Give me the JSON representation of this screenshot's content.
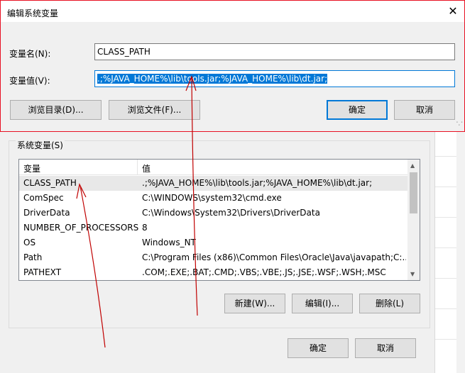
{
  "dialog": {
    "title": "编辑系统变量",
    "name_label": "变量名(N):",
    "name_value": "CLASS_PATH",
    "value_label": "变量值(V):",
    "value_text": ".;%JAVA_HOME%\\lib\\tools.jar;%JAVA_HOME%\\lib\\dt.jar;",
    "browse_dir": "浏览目录(D)...",
    "browse_file": "浏览文件(F)...",
    "ok": "确定",
    "cancel": "取消"
  },
  "sysvars": {
    "group_label": "系统变量(S)",
    "columns": [
      "变量",
      "值"
    ],
    "rows": [
      {
        "name": "CLASS_PATH",
        "value": ".;%JAVA_HOME%\\lib\\tools.jar;%JAVA_HOME%\\lib\\dt.jar;"
      },
      {
        "name": "ComSpec",
        "value": "C:\\WINDOWS\\system32\\cmd.exe"
      },
      {
        "name": "DriverData",
        "value": "C:\\Windows\\System32\\Drivers\\DriverData"
      },
      {
        "name": "NUMBER_OF_PROCESSORS",
        "value": "8"
      },
      {
        "name": "OS",
        "value": "Windows_NT"
      },
      {
        "name": "Path",
        "value": "C:\\Program Files (x86)\\Common Files\\Oracle\\Java\\javapath;C:..."
      },
      {
        "name": "PATHEXT",
        "value": ".COM;.EXE;.BAT;.CMD;.VBS;.VBE;.JS;.JSE;.WSF;.WSH;.MSC"
      }
    ],
    "new_btn": "新建(W)...",
    "edit_btn": "编辑(I)...",
    "delete_btn": "删除(L)"
  },
  "outer": {
    "ok": "确定",
    "cancel": "取消"
  },
  "colors": {
    "accent": "#0078d7",
    "dialog_border": "#e81123",
    "annotation": "#c00000"
  },
  "icons": [
    "close-icon",
    "scroll-up-icon",
    "scroll-down-icon",
    "resize-grip-icon"
  ]
}
